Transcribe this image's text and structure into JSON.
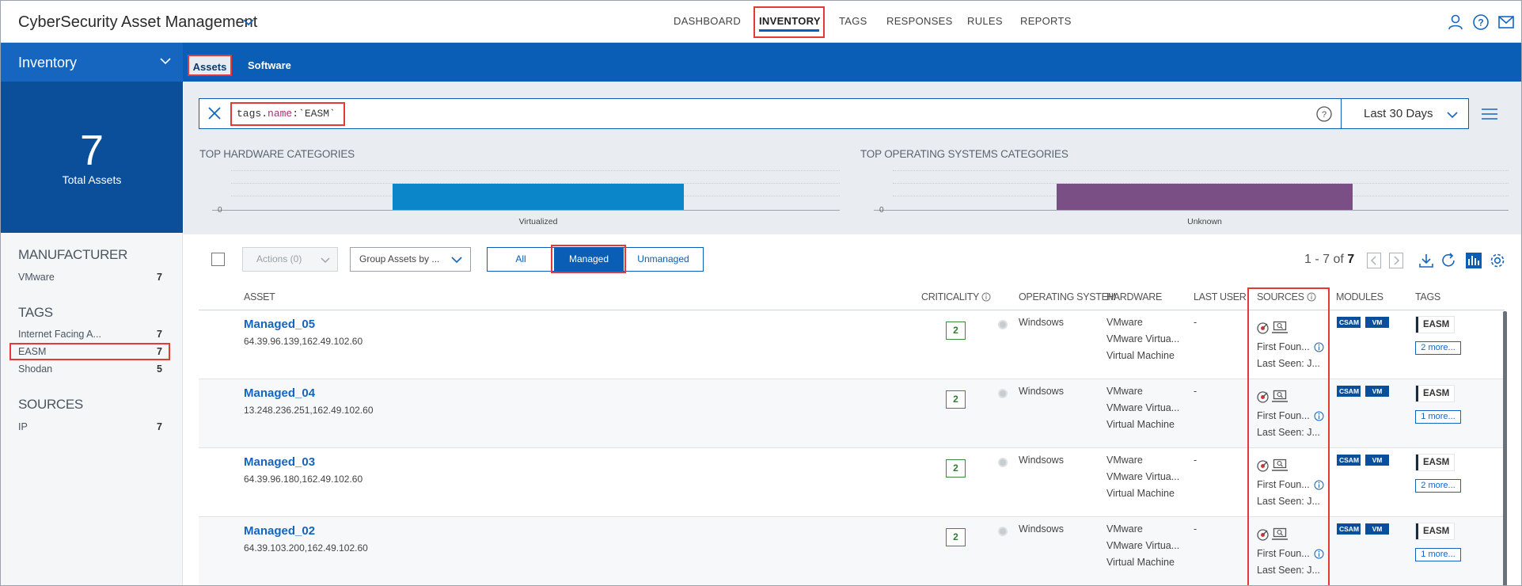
{
  "app": {
    "title": "CyberSecurity Asset Management"
  },
  "nav": {
    "items": [
      {
        "label": "DASHBOARD"
      },
      {
        "label": "INVENTORY"
      },
      {
        "label": "TAGS"
      },
      {
        "label": "RESPONSES"
      },
      {
        "label": "RULES"
      },
      {
        "label": "REPORTS"
      }
    ],
    "active": "INVENTORY"
  },
  "subnav": {
    "section": "Inventory",
    "tabs": [
      {
        "label": "Assets"
      },
      {
        "label": "Software"
      }
    ],
    "active": "Assets"
  },
  "summary": {
    "count": "7",
    "label": "Total Assets"
  },
  "filters": {
    "manufacturer": {
      "title": "MANUFACTURER",
      "items": [
        {
          "label": "VMware",
          "count": "7"
        }
      ]
    },
    "tags": {
      "title": "TAGS",
      "items": [
        {
          "label": "Internet Facing A...",
          "count": "7"
        },
        {
          "label": "EASM",
          "count": "7"
        },
        {
          "label": "Shodan",
          "count": "5"
        }
      ]
    },
    "sources": {
      "title": "SOURCES",
      "items": [
        {
          "label": "IP",
          "count": "7"
        }
      ]
    }
  },
  "search": {
    "query_prefix": "tags.",
    "query_field": "name",
    "query_suffix": ":`EASM`",
    "date_range": "Last 30 Days"
  },
  "charts": {
    "hardware": {
      "title": "TOP HARDWARE CATEGORIES",
      "zero": "0",
      "category": "Virtualized",
      "color": "#0a86c9"
    },
    "os": {
      "title": "TOP OPERATING SYSTEMS CATEGORIES",
      "zero": "0",
      "category": "Unknown",
      "color": "#7a4f85"
    }
  },
  "chart_data": [
    {
      "type": "bar",
      "title": "TOP HARDWARE CATEGORIES",
      "categories": [
        "Virtualized"
      ],
      "values": [
        7
      ]
    },
    {
      "type": "bar",
      "title": "TOP OPERATING SYSTEMS CATEGORIES",
      "categories": [
        "Unknown"
      ],
      "values": [
        7
      ]
    }
  ],
  "toolbar": {
    "actions": "Actions (0)",
    "group_by": "Group Assets by ...",
    "segments": [
      "All",
      "Managed",
      "Unmanaged"
    ],
    "active_segment": "Managed",
    "paging_range": "1 - 7 of",
    "paging_total": "7"
  },
  "table": {
    "headers": {
      "asset": "ASSET",
      "criticality": "CRITICALITY",
      "os": "OPERATING SYSTEM",
      "hardware": "HARDWARE",
      "last_user": "LAST USER",
      "sources": "SOURCES",
      "modules": "MODULES",
      "tags": "TAGS"
    },
    "rows": [
      {
        "name": "Managed_05",
        "ip": "64.39.96.139,162.49.102.60",
        "criticality": "2",
        "os": "Windsows",
        "hw1": "VMware",
        "hw2": "VMware Virtua...",
        "hw3": "Virtual Machine",
        "last_user": "-",
        "first_found": "First Foun...",
        "last_seen": "Last Seen: J...",
        "modules": [
          "CSAM",
          "VM"
        ],
        "tag": "EASM",
        "more": "2 more..."
      },
      {
        "name": "Managed_04",
        "ip": "13.248.236.251,162.49.102.60",
        "criticality": "2",
        "os": "Windsows",
        "hw1": "VMware",
        "hw2": "VMware Virtua...",
        "hw3": "Virtual Machine",
        "last_user": "-",
        "first_found": "First Foun...",
        "last_seen": "Last Seen: J...",
        "modules": [
          "CSAM",
          "VM"
        ],
        "tag": "EASM",
        "more": "1 more..."
      },
      {
        "name": "Managed_03",
        "ip": "64.39.96.180,162.49.102.60",
        "criticality": "2",
        "os": "Windsows",
        "hw1": "VMware",
        "hw2": "VMware Virtua...",
        "hw3": "Virtual Machine",
        "last_user": "-",
        "first_found": "First Foun...",
        "last_seen": "Last Seen: J...",
        "modules": [
          "CSAM",
          "VM"
        ],
        "tag": "EASM",
        "more": "2 more..."
      },
      {
        "name": "Managed_02",
        "ip": "64.39.103.200,162.49.102.60",
        "criticality": "2",
        "os": "Windsows",
        "hw1": "VMware",
        "hw2": "VMware Virtua...",
        "hw3": "Virtual Machine",
        "last_user": "-",
        "first_found": "First Foun...",
        "last_seen": "Last Seen: J...",
        "modules": [
          "CSAM",
          "VM"
        ],
        "tag": "EASM",
        "more": "1 more..."
      }
    ]
  },
  "icons": {
    "app_chevron": "chevron-down-icon",
    "user": "user-icon",
    "help": "help-icon",
    "mail": "mail-icon",
    "clear": "close-icon",
    "menu": "hamburger-icon",
    "download": "download-icon",
    "refresh": "refresh-icon",
    "chart": "chart-icon",
    "settings": "gear-icon",
    "prev": "chevron-left-icon",
    "next": "chevron-right-icon",
    "source_scan": "scanner-icon",
    "source_agent": "laptop-search-icon",
    "info": "info-icon"
  },
  "colors": {
    "brand": "#0a5eb6",
    "highlight": "#e53935",
    "criticality": "#2e7d32"
  }
}
